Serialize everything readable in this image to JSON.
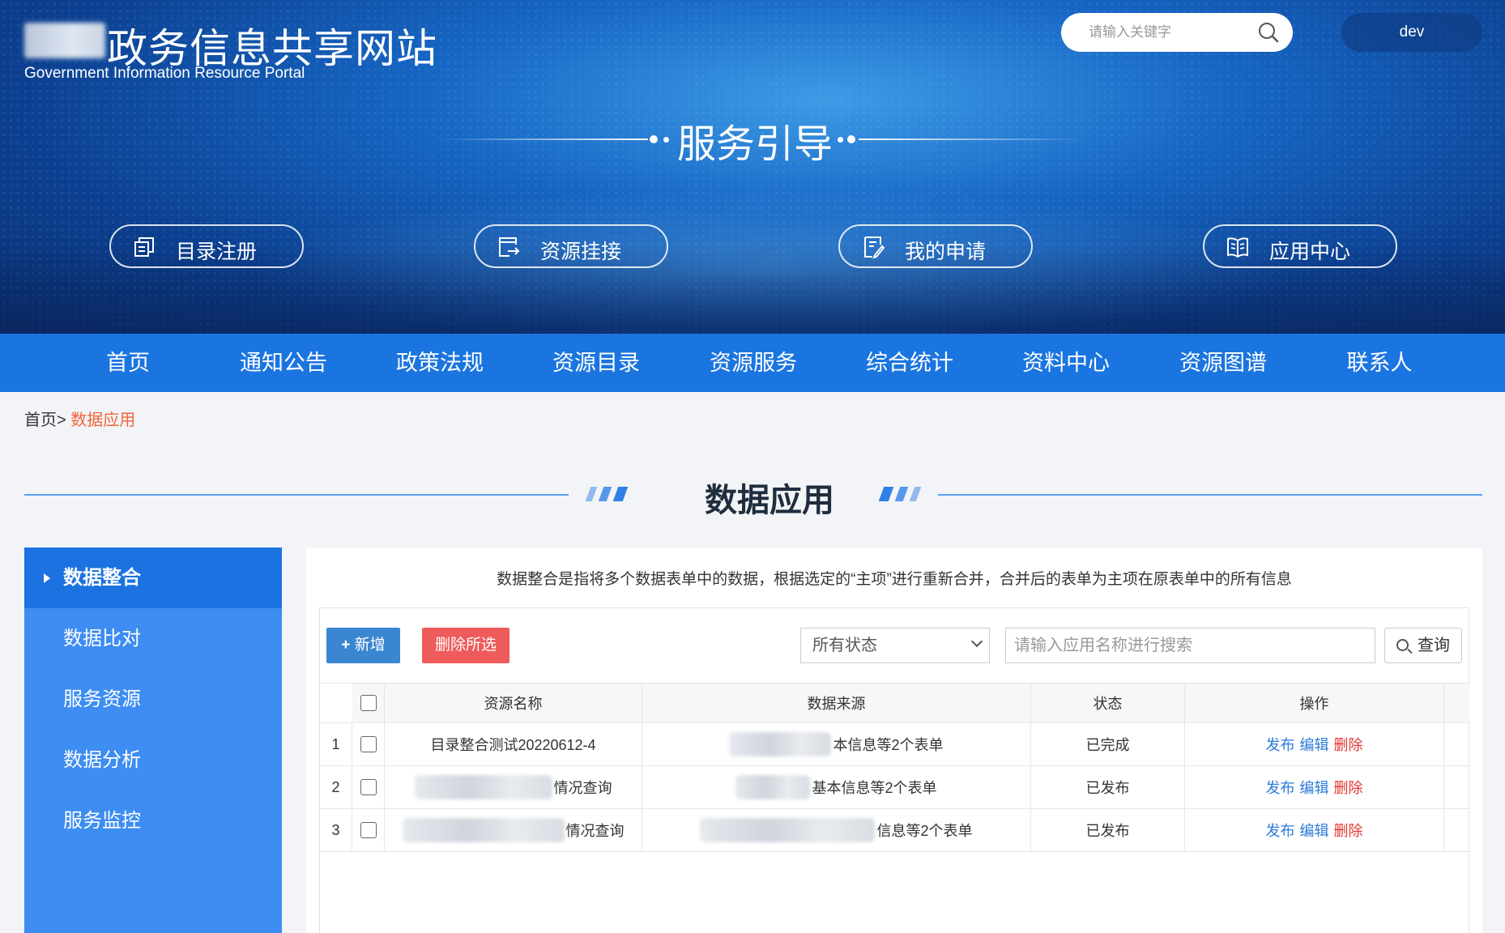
{
  "header": {
    "site_title": "政务信息共享网站",
    "site_subtitle": "Government Information Resource Portal",
    "search_placeholder": "请输入关键字",
    "user_name": "dev",
    "guide_title": "服务引导",
    "service_buttons": [
      {
        "label": "目录注册",
        "icon": "catalog-register-icon"
      },
      {
        "label": "资源挂接",
        "icon": "resource-mount-icon"
      },
      {
        "label": "我的申请",
        "icon": "my-application-icon"
      },
      {
        "label": "应用中心",
        "icon": "app-center-icon"
      }
    ]
  },
  "nav": {
    "items": [
      "首页",
      "通知公告",
      "政策法规",
      "资源目录",
      "资源服务",
      "综合统计",
      "资料中心",
      "资源图谱",
      "联系人"
    ]
  },
  "breadcrumb": {
    "home": "首页>",
    "current": "数据应用"
  },
  "section_title": "数据应用",
  "sidebar": {
    "items": [
      {
        "label": "数据整合",
        "active": true
      },
      {
        "label": "数据比对",
        "active": false
      },
      {
        "label": "服务资源",
        "active": false
      },
      {
        "label": "数据分析",
        "active": false
      },
      {
        "label": "服务监控",
        "active": false
      }
    ]
  },
  "main": {
    "description": "数据整合是指将多个数据表单中的数据，根据选定的“主项”进行重新合并，合并后的表单为主项在原表单中的所有信息",
    "toolbar": {
      "add_label": "新增",
      "delete_selected_label": "删除所选",
      "status_select_value": "所有状态",
      "search_placeholder": "请输入应用名称进行搜索",
      "query_label": "查询"
    },
    "table": {
      "columns": [
        "资源名称",
        "数据来源",
        "状态",
        "操作"
      ],
      "rows": [
        {
          "num": "1",
          "name": "目录整合测试20220612-4",
          "source": "本信息等2个表单",
          "status": "已完成",
          "actions": [
            "发布",
            "编辑",
            "删除"
          ]
        },
        {
          "num": "2",
          "name": "情况查询",
          "source": "基本信息等2个表单",
          "status": "已发布",
          "actions": [
            "发布",
            "编辑",
            "删除"
          ]
        },
        {
          "num": "3",
          "name": "情况查询",
          "source": "信息等2个表单",
          "status": "已发布",
          "actions": [
            "发布",
            "编辑",
            "删除"
          ]
        }
      ]
    }
  },
  "colors": {
    "nav_bg": "#1b75e0",
    "sidebar_bg": "#3d8df2",
    "sidebar_active": "#1b72e0",
    "add_button": "#3a86d1",
    "delete_button": "#ef5b5b",
    "breadcrumb_current": "#f0643c",
    "link_blue": "#2a7ad8",
    "link_red": "#e3342f"
  }
}
